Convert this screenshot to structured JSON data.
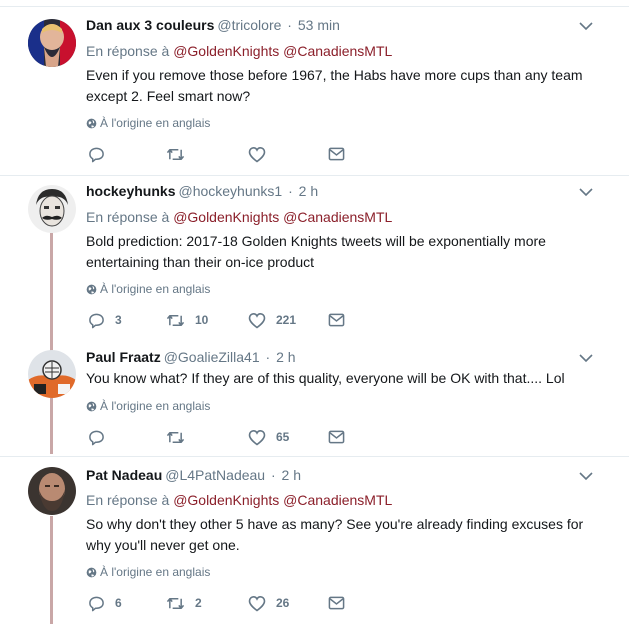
{
  "tweets": [
    {
      "name": "Dan aux 3 couleurs",
      "handle": "@tricolore",
      "dot": "·",
      "time": "53 min",
      "reply_prefix": "En réponse à",
      "mentions": [
        "@GoldenKnights",
        "@CanadiensMTL"
      ],
      "text": "Even if you remove those before 1967, the Habs have more cups than any team except 2. Feel smart now?",
      "origin": "À l'origine en anglais",
      "replies": "",
      "retweets": "",
      "likes": ""
    },
    {
      "name": "hockeyhunks",
      "handle": "@hockeyhunks1",
      "dot": "·",
      "time": "2 h",
      "reply_prefix": "En réponse à",
      "mentions": [
        "@GoldenKnights",
        "@CanadiensMTL"
      ],
      "text": "Bold prediction: 2017-18 Golden Knights tweets will be exponentially more entertaining than their on-ice product",
      "origin": "À l'origine en anglais",
      "replies": "3",
      "retweets": "10",
      "likes": "221"
    },
    {
      "name": "Paul Fraatz",
      "handle": "@GoalieZilla41",
      "dot": "·",
      "time": "2 h",
      "text": "You know what?  If they are of this quality,  everyone will be OK with that.... Lol",
      "origin": "À l'origine en anglais",
      "replies": "",
      "retweets": "",
      "likes": "65"
    },
    {
      "name": "Pat Nadeau",
      "handle": "@L4PatNadeau",
      "dot": "·",
      "time": "2 h",
      "reply_prefix": "En réponse à",
      "mentions": [
        "@GoldenKnights",
        "@CanadiensMTL"
      ],
      "text": "So why don't they other 5 have as many? See you're already finding excuses for why you'll never get one.",
      "origin": "À l'origine en anglais",
      "replies": "6",
      "retweets": "2",
      "likes": "26"
    }
  ],
  "icons": {
    "reply": "reply-icon",
    "retweet": "retweet-icon",
    "like": "heart-icon",
    "dm": "envelope-icon",
    "globe": "globe-icon",
    "more": "chevron-down-icon"
  },
  "colors": {
    "mention": "#8b1f2a",
    "muted": "#657786",
    "thread": "#c9a7a7"
  }
}
